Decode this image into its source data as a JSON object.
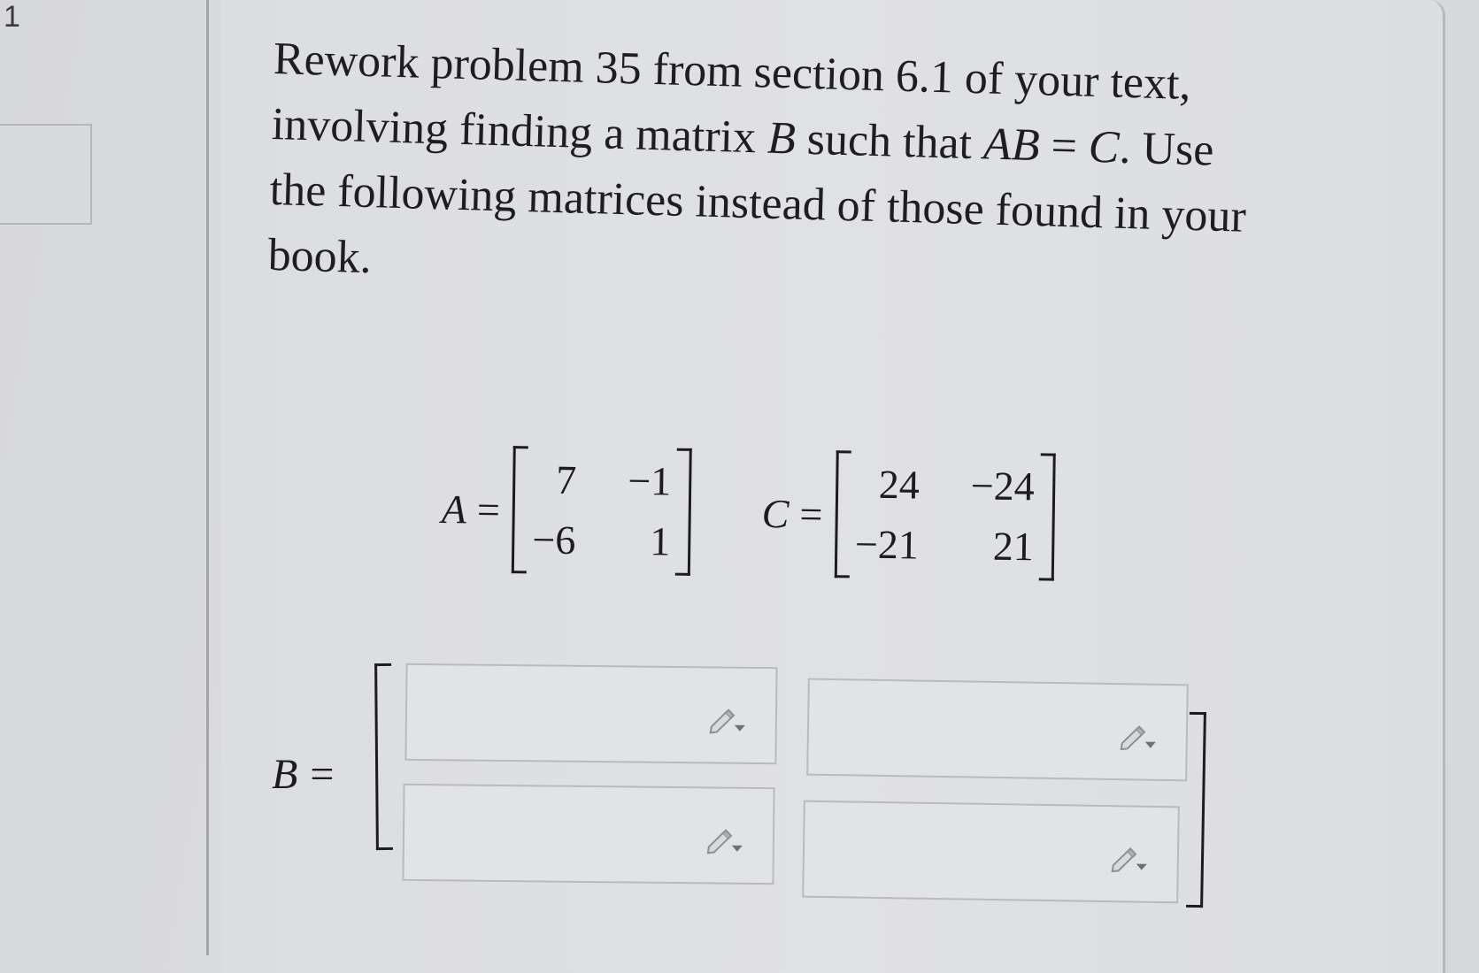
{
  "question_number": "1",
  "prompt": {
    "lines": [
      "Rework problem 35 from section 6.1 of your text,",
      [
        "involving finding a matrix ",
        "B",
        " such that ",
        "AB",
        " = ",
        "C",
        ". Use"
      ],
      "the following matrices instead of those found in your",
      "book."
    ]
  },
  "matrix_A": {
    "label": "A",
    "equals": "=",
    "rows": [
      [
        "7",
        "−1"
      ],
      [
        "−6",
        "1"
      ]
    ]
  },
  "matrix_C": {
    "label": "C",
    "equals": "=",
    "rows": [
      [
        "24",
        "−24"
      ],
      [
        "−21",
        "21"
      ]
    ]
  },
  "answer": {
    "label": "B",
    "equals": "=",
    "cells": [
      {
        "row": 1,
        "col": 1,
        "value": ""
      },
      {
        "row": 1,
        "col": 2,
        "value": ""
      },
      {
        "row": 2,
        "col": 1,
        "value": ""
      },
      {
        "row": 2,
        "col": 2,
        "value": ""
      }
    ],
    "pencil_icon": "pencil-dropdown-icon"
  },
  "colors": {
    "text": "#1c1c1e",
    "cell_border": "#b9babd",
    "cell_bg": "#e2e3e5"
  }
}
